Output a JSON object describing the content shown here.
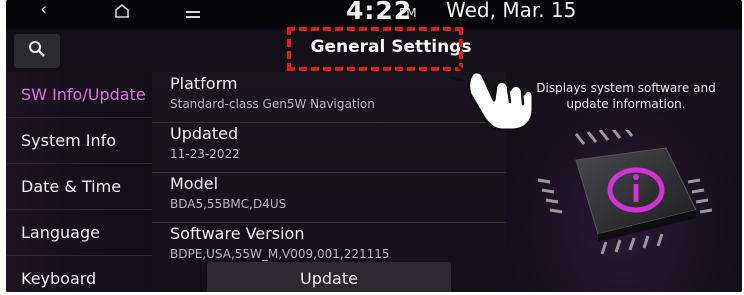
{
  "status_bar": {
    "back_icon": "chevron-left-icon",
    "home_icon": "home-icon",
    "menu_icon": "menu-icon",
    "time": "4:22",
    "ampm": "PM",
    "date": "Wed, Mar. 15"
  },
  "header": {
    "search_icon": "search-icon",
    "title": "General Settings"
  },
  "sidebar": {
    "items": [
      {
        "label": "SW Info/Update",
        "active": true
      },
      {
        "label": "System Info"
      },
      {
        "label": "Date & Time"
      },
      {
        "label": "Language"
      },
      {
        "label": "Keyboard"
      }
    ]
  },
  "main": {
    "rows": [
      {
        "label": "Platform",
        "value": "Standard-class Gen5W Navigation"
      },
      {
        "label": "Updated",
        "value": "11-23-2022"
      },
      {
        "label": "Model",
        "value": "BDA5,55BMC,D4US"
      },
      {
        "label": "Software Version",
        "value": "BDPE,USA,55W_M,V009,001,221115"
      }
    ],
    "update_button": "Update"
  },
  "info_panel": {
    "description": "Displays system software and update information.",
    "chip_icon": "info-chip-icon"
  },
  "colors": {
    "accent": "#e070e6",
    "highlight": "#e01b1b"
  }
}
